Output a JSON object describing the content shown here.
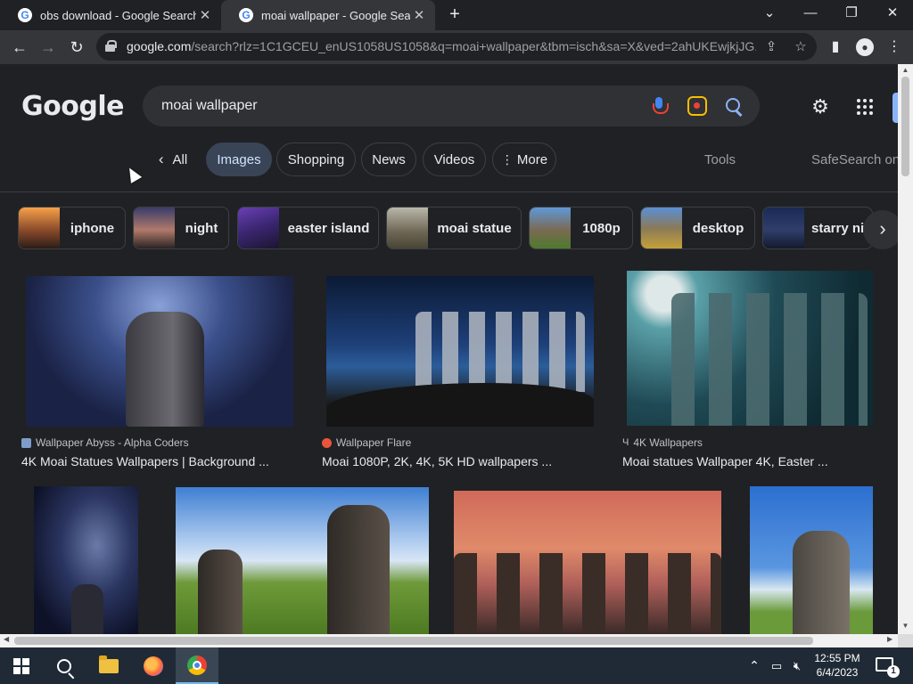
{
  "browser": {
    "tabs": [
      {
        "title": "obs download - Google Search",
        "favicon": "G"
      },
      {
        "title": "moai wallpaper - Google Search",
        "favicon": "G"
      }
    ],
    "url_host": "google.com",
    "url_rest": "/search?rlz=1C1GCEU_enUS1058US1058&q=moai+wallpaper&tbm=isch&sa=X&ved=2ahUKEwjkjJG..."
  },
  "google": {
    "logo": "Google",
    "query": "moai wallpaper",
    "filters": {
      "all": "All",
      "images": "Images",
      "shopping": "Shopping",
      "news": "News",
      "videos": "Videos",
      "more": "More"
    },
    "tools": "Tools",
    "safesearch": "SafeSearch on",
    "chips": [
      "iphone",
      "night",
      "easter island",
      "moai statue",
      "1080p",
      "desktop",
      "starry night"
    ],
    "results": [
      {
        "source": "Wallpaper Abyss - Alpha Coders",
        "title": "4K Moai Statues Wallpapers | Background ..."
      },
      {
        "source": "Wallpaper Flare",
        "title": "Moai 1080P, 2K, 4K, 5K HD wallpapers ..."
      },
      {
        "source": "4K Wallpapers",
        "title": "Moai statues Wallpaper 4K, Easter ..."
      }
    ]
  },
  "taskbar": {
    "time": "12:55 PM",
    "date": "6/4/2023",
    "notification_count": "1"
  }
}
